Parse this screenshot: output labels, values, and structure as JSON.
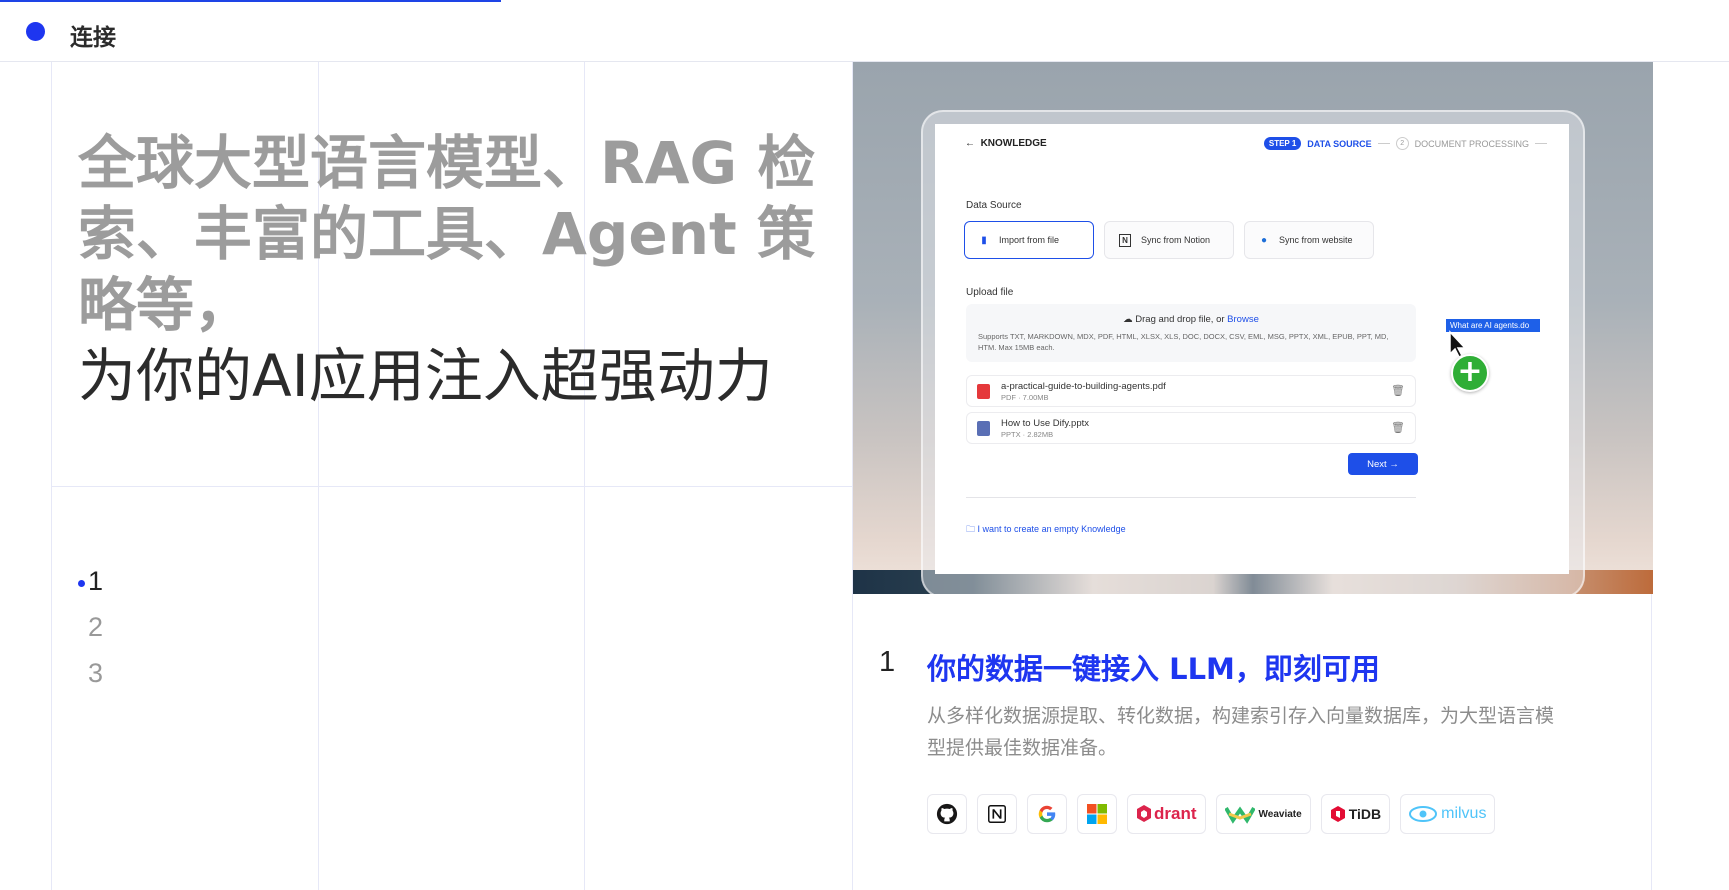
{
  "header": {
    "title": "连接",
    "progress_percent": 29
  },
  "headline": {
    "muted_text": "全球大型语言模型、RAG 检索、丰富的工具、Agent 策略等，",
    "emphasis_text": "为你的AI应用注入超强动力"
  },
  "stepper": {
    "items": [
      "1",
      "2",
      "3"
    ],
    "active_index": 0
  },
  "screenshot": {
    "back_label": "KNOWLEDGE",
    "step1_badge": "STEP 1",
    "step1_label": "DATA SOURCE",
    "step2_number": "2",
    "step2_label": "DOCUMENT PROCESSING",
    "data_source_label": "Data Source",
    "options": [
      "Import from file",
      "Sync from Notion",
      "Sync from website"
    ],
    "upload_label": "Upload file",
    "dropzone_text": "Drag and drop file, or ",
    "dropzone_browse": "Browse",
    "dropzone_sub": "Supports TXT, MARKDOWN, MDX, PDF, HTML, XLSX, XLS, DOC, DOCX, CSV, EML, MSG, PPTX, XML, EPUB, PPT, MD, HTM. Max 15MB each.",
    "files": [
      {
        "name": "a-practical-guide-to-building-agents.pdf",
        "meta": "PDF · 7.00MB"
      },
      {
        "name": "How to Use Dify.pptx",
        "meta": "PPTX · 2.82MB"
      }
    ],
    "next_label": "Next →",
    "empty_knowledge_link": "I want to create an empty Knowledge",
    "drag_file_name": "What are AI agents.do"
  },
  "feature": {
    "number": "1",
    "title": "你的数据一键接入 LLM，即刻可用",
    "description": "从多样化数据源提取、转化数据，构建索引存入向量数据库，为大型语言模型提供最佳数据准备。"
  },
  "integrations": [
    {
      "icon": "github-icon"
    },
    {
      "icon": "notion-icon"
    },
    {
      "icon": "google-icon"
    },
    {
      "icon": "microsoft-icon"
    },
    {
      "icon": "qdrant-icon",
      "label": "drant"
    },
    {
      "icon": "weaviate-icon",
      "label": "Weaviate"
    },
    {
      "icon": "tidb-icon",
      "label": "TiDB"
    },
    {
      "icon": "milvus-icon",
      "label": "milvus"
    }
  ],
  "colors": {
    "accent": "#1e36f0",
    "muted_text": "#9c9c9c",
    "ui_blue": "#1e4fe8",
    "green_plus": "#2fae36"
  }
}
